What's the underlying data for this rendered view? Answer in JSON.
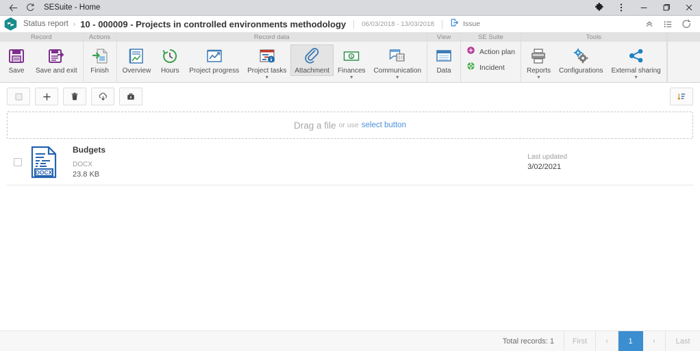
{
  "browser": {
    "title": "SESuite - Home",
    "back_icon": "back-arrow-icon",
    "reload_icon": "reload-icon",
    "extensions_icon": "extensions-puzzle-icon",
    "menu_icon": "three-dot-menu-icon",
    "minimize_icon": "minimize-icon",
    "maximize_icon": "maximize-icon",
    "close_icon": "close-icon"
  },
  "header": {
    "logo": "sesuite-hexagon-logo",
    "breadcrumb_root": "Status report",
    "breadcrumb_sep": "›",
    "record_title": "10 - 000009 - Projects in controlled environments methodology",
    "date_range": "06/03/2018 - 13/03/2018",
    "issue_label": "Issue",
    "issue_icon": "issue-export-icon",
    "collapse_icon": "double-chevron-up-icon",
    "list_icon": "list-menu-icon",
    "refresh_icon": "refresh-icon"
  },
  "ribbon": {
    "groups": [
      {
        "title": "Record",
        "type": "buttons",
        "items": [
          {
            "label": "Save",
            "icon": "save-floppy-icon",
            "caret": false,
            "active": false
          },
          {
            "label": "Save and exit",
            "icon": "save-and-exit-icon",
            "caret": false,
            "active": false
          }
        ]
      },
      {
        "title": "Actions",
        "type": "buttons",
        "items": [
          {
            "label": "Finish",
            "icon": "finish-icon",
            "caret": false,
            "active": false
          }
        ]
      },
      {
        "title": "Record data",
        "type": "buttons",
        "items": [
          {
            "label": "Overview",
            "icon": "overview-clipboard-icon",
            "caret": false,
            "active": false
          },
          {
            "label": "Hours",
            "icon": "hours-clock-icon",
            "caret": false,
            "active": false
          },
          {
            "label": "Project progress",
            "icon": "project-progress-chart-icon",
            "caret": false,
            "active": false
          },
          {
            "label": "Project tasks",
            "icon": "project-tasks-icon",
            "caret": true,
            "active": false
          },
          {
            "label": "Attachment",
            "icon": "attachment-paperclip-icon",
            "caret": false,
            "active": true
          },
          {
            "label": "Finances",
            "icon": "finances-money-icon",
            "caret": true,
            "active": false
          },
          {
            "label": "Communication",
            "icon": "communication-chat-icon",
            "caret": true,
            "active": false
          }
        ]
      },
      {
        "title": "View",
        "type": "buttons",
        "items": [
          {
            "label": "Data",
            "icon": "data-window-icon",
            "caret": false,
            "active": false
          }
        ]
      },
      {
        "title": "SE Suite",
        "type": "list",
        "items": [
          {
            "label": "Action plan",
            "icon": "action-plan-icon"
          },
          {
            "label": "Incident",
            "icon": "incident-icon"
          }
        ]
      },
      {
        "title": "Tools",
        "type": "buttons",
        "items": [
          {
            "label": "Reports",
            "icon": "reports-printer-icon",
            "caret": true,
            "active": false
          },
          {
            "label": "Configurations",
            "icon": "configurations-gears-icon",
            "caret": false,
            "active": false
          },
          {
            "label": "External sharing",
            "icon": "external-sharing-icon",
            "caret": true,
            "active": false
          }
        ]
      }
    ]
  },
  "toolbar": {
    "buttons": [
      {
        "name": "select-all-checkbox-button",
        "icon": "checkbox-square-icon"
      },
      {
        "name": "add-attachment-button",
        "icon": "plus-icon"
      },
      {
        "name": "delete-attachment-button",
        "icon": "trash-icon"
      },
      {
        "name": "download-attachment-button",
        "icon": "cloud-download-icon"
      },
      {
        "name": "archive-button",
        "icon": "briefcase-icon"
      }
    ],
    "sort_button": {
      "name": "sort-button",
      "icon": "sort-descending-icon"
    }
  },
  "dropzone": {
    "strong": "Drag a file",
    "middle": "or use",
    "link": "select button"
  },
  "filelist": {
    "columns": {
      "last_updated": "Last updated"
    },
    "rows": [
      {
        "name": "Budgets",
        "type": "DOCX",
        "size": "23.8 KB",
        "last_updated_label": "Last updated",
        "last_updated": "3/02/2021",
        "icon": "docx-file-icon",
        "checked": false
      }
    ]
  },
  "footer": {
    "total_records": "Total records: 1",
    "first": "First",
    "prev": "‹",
    "page_current": "1",
    "next": "›",
    "last": "Last"
  },
  "colors": {
    "accent_blue": "#3b8ed0",
    "link_blue": "#4a90d9",
    "logo_teal": "#1a8c8c",
    "save_purple": "#7e2f8e",
    "finish_green": "#3aa14b",
    "action_plan_purple": "#b53a9b",
    "incident_green": "#4caf50"
  }
}
